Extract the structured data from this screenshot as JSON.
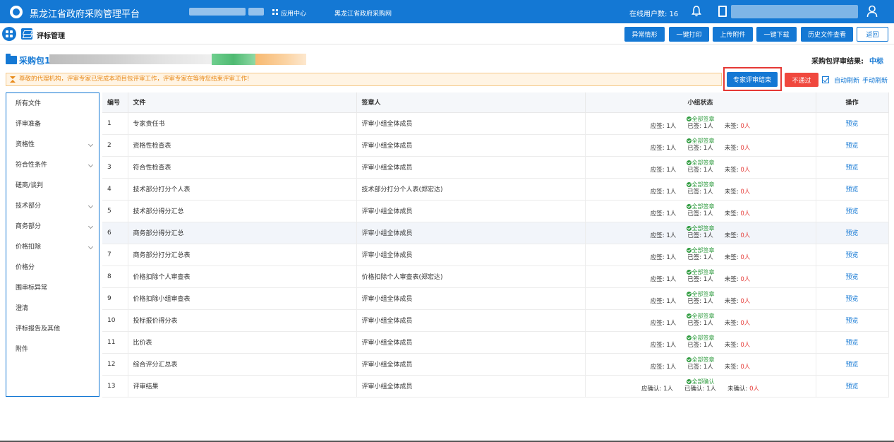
{
  "topbar": {
    "title": "黑龙江省政府采购管理平台",
    "app_center": "应用中心",
    "nav_link": "黑龙江省政府采购网",
    "online_label": "在线用户数: 16"
  },
  "toolbar": {
    "title": "评标管理",
    "buttons": [
      "异常情形",
      "一键打印",
      "上传附件",
      "一键下载",
      "历史文件查看"
    ],
    "back": "返回"
  },
  "package": {
    "title": "采购包1",
    "result_label": "采购包评审结果:",
    "result_value": "中标"
  },
  "notice": {
    "text": "尊敬的代理机构，评审专家已完成本项目包评审工作，评审专家在等待您结束评审工作!",
    "finish_button": "专家评审结束",
    "reject_button": "不通过",
    "auto_refresh": "自动刷新",
    "manual_refresh": "手动刷新"
  },
  "sidebar": {
    "items": [
      {
        "label": "所有文件",
        "expandable": false
      },
      {
        "label": "评审准备",
        "expandable": false
      },
      {
        "label": "资格性",
        "expandable": true
      },
      {
        "label": "符合性条件",
        "expandable": true
      },
      {
        "label": "磋商/谈判",
        "expandable": false
      },
      {
        "label": "技术部分",
        "expandable": true
      },
      {
        "label": "商务部分",
        "expandable": true
      },
      {
        "label": "价格扣除",
        "expandable": true
      },
      {
        "label": "价格分",
        "expandable": false
      },
      {
        "label": "围串标异常",
        "expandable": false
      },
      {
        "label": "澄清",
        "expandable": false
      },
      {
        "label": "评标报告及其他",
        "expandable": false
      },
      {
        "label": "附件",
        "expandable": false
      }
    ]
  },
  "table": {
    "headers": [
      "编号",
      "文件",
      "签章人",
      "小组状态",
      "操作"
    ],
    "rows": [
      {
        "no": "1",
        "file": "专家责任书",
        "signer": "评审小组全体成员",
        "status": "全部签章",
        "c1l": "应签:",
        "c1v": "1人",
        "c2l": "已签:",
        "c2v": "1人",
        "c3l": "未签:",
        "c3v": "0人",
        "action": "预览"
      },
      {
        "no": "2",
        "file": "资格性检查表",
        "signer": "评审小组全体成员",
        "status": "全部签章",
        "c1l": "应签:",
        "c1v": "1人",
        "c2l": "已签:",
        "c2v": "1人",
        "c3l": "未签:",
        "c3v": "0人",
        "action": "预览"
      },
      {
        "no": "3",
        "file": "符合性检查表",
        "signer": "评审小组全体成员",
        "status": "全部签章",
        "c1l": "应签:",
        "c1v": "1人",
        "c2l": "已签:",
        "c2v": "1人",
        "c3l": "未签:",
        "c3v": "0人",
        "action": "预览"
      },
      {
        "no": "4",
        "file": "技术部分打分个人表",
        "signer": "技术部分打分个人表(郑宏达)",
        "status": "全部签章",
        "c1l": "应签:",
        "c1v": "1人",
        "c2l": "已签:",
        "c2v": "1人",
        "c3l": "未签:",
        "c3v": "0人",
        "action": "预览"
      },
      {
        "no": "5",
        "file": "技术部分得分汇总",
        "signer": "评审小组全体成员",
        "status": "全部签章",
        "c1l": "应签:",
        "c1v": "1人",
        "c2l": "已签:",
        "c2v": "1人",
        "c3l": "未签:",
        "c3v": "0人",
        "action": "预览"
      },
      {
        "no": "6",
        "file": "商务部分得分汇总",
        "signer": "评审小组全体成员",
        "status": "全部签章",
        "c1l": "应签:",
        "c1v": "1人",
        "c2l": "已签:",
        "c2v": "1人",
        "c3l": "未签:",
        "c3v": "0人",
        "action": "预览"
      },
      {
        "no": "7",
        "file": "商务部分打分汇总表",
        "signer": "评审小组全体成员",
        "status": "全部签章",
        "c1l": "应签:",
        "c1v": "1人",
        "c2l": "已签:",
        "c2v": "1人",
        "c3l": "未签:",
        "c3v": "0人",
        "action": "预览"
      },
      {
        "no": "8",
        "file": "价格扣除个人审查表",
        "signer": "价格扣除个人审查表(郑宏达)",
        "status": "全部签章",
        "c1l": "应签:",
        "c1v": "1人",
        "c2l": "已签:",
        "c2v": "1人",
        "c3l": "未签:",
        "c3v": "0人",
        "action": "预览"
      },
      {
        "no": "9",
        "file": "价格扣除小组审查表",
        "signer": "评审小组全体成员",
        "status": "全部签章",
        "c1l": "应签:",
        "c1v": "1人",
        "c2l": "已签:",
        "c2v": "1人",
        "c3l": "未签:",
        "c3v": "0人",
        "action": "预览"
      },
      {
        "no": "10",
        "file": "投标报价得分表",
        "signer": "评审小组全体成员",
        "status": "全部签章",
        "c1l": "应签:",
        "c1v": "1人",
        "c2l": "已签:",
        "c2v": "1人",
        "c3l": "未签:",
        "c3v": "0人",
        "action": "预览"
      },
      {
        "no": "11",
        "file": "比价表",
        "signer": "评审小组全体成员",
        "status": "全部签章",
        "c1l": "应签:",
        "c1v": "1人",
        "c2l": "已签:",
        "c2v": "1人",
        "c3l": "未签:",
        "c3v": "0人",
        "action": "预览"
      },
      {
        "no": "12",
        "file": "综合评分汇总表",
        "signer": "评审小组全体成员",
        "status": "全部签章",
        "c1l": "应签:",
        "c1v": "1人",
        "c2l": "已签:",
        "c2v": "1人",
        "c3l": "未签:",
        "c3v": "0人",
        "action": "预览"
      },
      {
        "no": "13",
        "file": "评审结果",
        "signer": "评审小组全体成员",
        "status": "全部确认",
        "c1l": "应确认:",
        "c1v": "1人",
        "c2l": "已确认:",
        "c2v": "1人",
        "c3l": "未确认:",
        "c3v": "0人",
        "action": "预览"
      }
    ]
  }
}
